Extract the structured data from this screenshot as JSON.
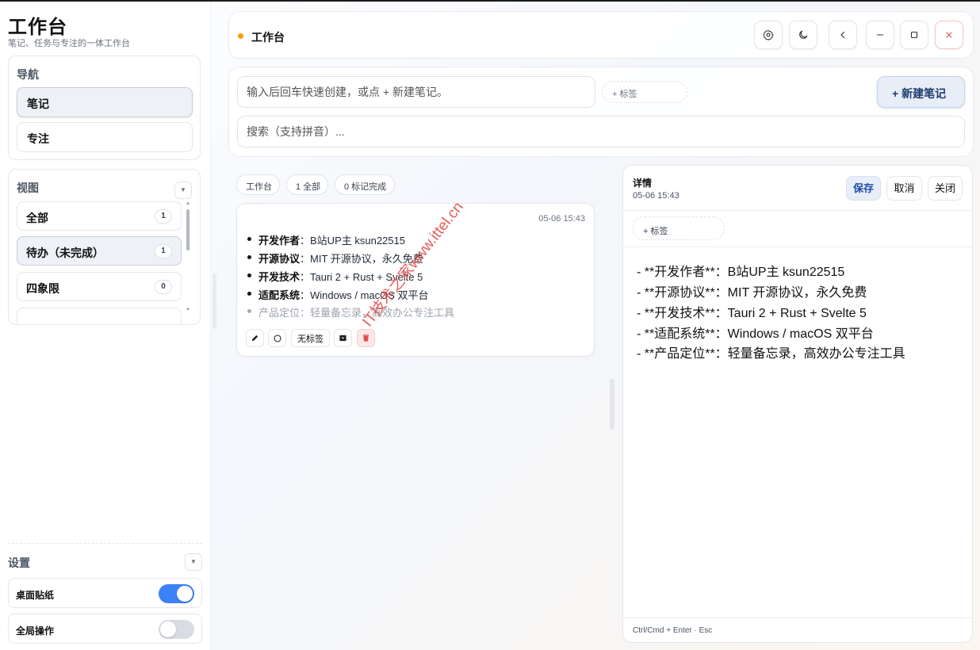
{
  "app": {
    "title": "工作台",
    "subtitle": "笔记、任务与专注的一体工作台"
  },
  "sidebar": {
    "nav_title": "导航",
    "nav_items": [
      {
        "label": "笔记",
        "active": true
      },
      {
        "label": "专注",
        "active": false
      }
    ],
    "view_title": "视图",
    "view_items": [
      {
        "label": "全部",
        "count": "1"
      },
      {
        "label": "待办（未完成）",
        "count": "1"
      },
      {
        "label": "四象限",
        "count": "0"
      }
    ],
    "settings_title": "设置",
    "settings": [
      {
        "label": "桌面贴纸",
        "enabled": true
      },
      {
        "label": "全局操作",
        "enabled": false
      }
    ]
  },
  "header": {
    "title": "工作台",
    "status_color": "#f59e0b",
    "buttons": [
      "settings-icon",
      "moon-icon",
      "chevron-left-icon",
      "minimize-icon",
      "maximize-icon",
      "close-icon"
    ]
  },
  "composer": {
    "quick_placeholder": "输入后回车快速创建，或点 + 新建笔记。",
    "tag_label": "+   标签",
    "new_note_label": "+  新建笔记",
    "search_placeholder": "搜索（支持拼音）..."
  },
  "chips": [
    "工作台",
    "1 全部",
    "0 标记完成"
  ],
  "note": {
    "time": "05-06 15:43",
    "lines": [
      {
        "key": "开发作者",
        "value": "：B站UP主 ksun22515"
      },
      {
        "key": "开源协议",
        "value": "：MIT 开源协议，永久免费"
      },
      {
        "key": "开发技术",
        "value": "：Tauri 2 + Rust + Svelte 5"
      },
      {
        "key": "适配系统",
        "value": "：Windows / macOS 双平台"
      },
      {
        "key": "产品定位",
        "value": "：轻量备忘录，高效办公专注工具"
      }
    ],
    "actions": {
      "edit": "edit-icon",
      "toggle": "circle-icon",
      "tag": "无标签",
      "archive": "archive-icon",
      "delete": "trash-icon"
    }
  },
  "detail": {
    "title": "详情",
    "time": "05-06 15:43",
    "save_label": "保存",
    "cancel_label": "取消",
    "close_label": "关闭",
    "tag_label": "+ 标签",
    "content": [
      "- **开发作者**：B站UP主 ksun22515",
      "- **开源协议**：MIT 开源协议，永久免费",
      "- **开发技术**：Tauri 2 + Rust + Svelte 5",
      "- **适配系统**：Windows / macOS 双平台",
      "- **产品定位**：轻量备忘录，高效办公专注工具"
    ],
    "hint": "Ctrl/Cmd + Enter · Esc"
  },
  "watermark": "IT技术之家www.ittel.cn",
  "colors": {
    "accent": "#3b82f6",
    "danger": "#e14b4b",
    "primary_button_text": "#1e4fa8"
  }
}
